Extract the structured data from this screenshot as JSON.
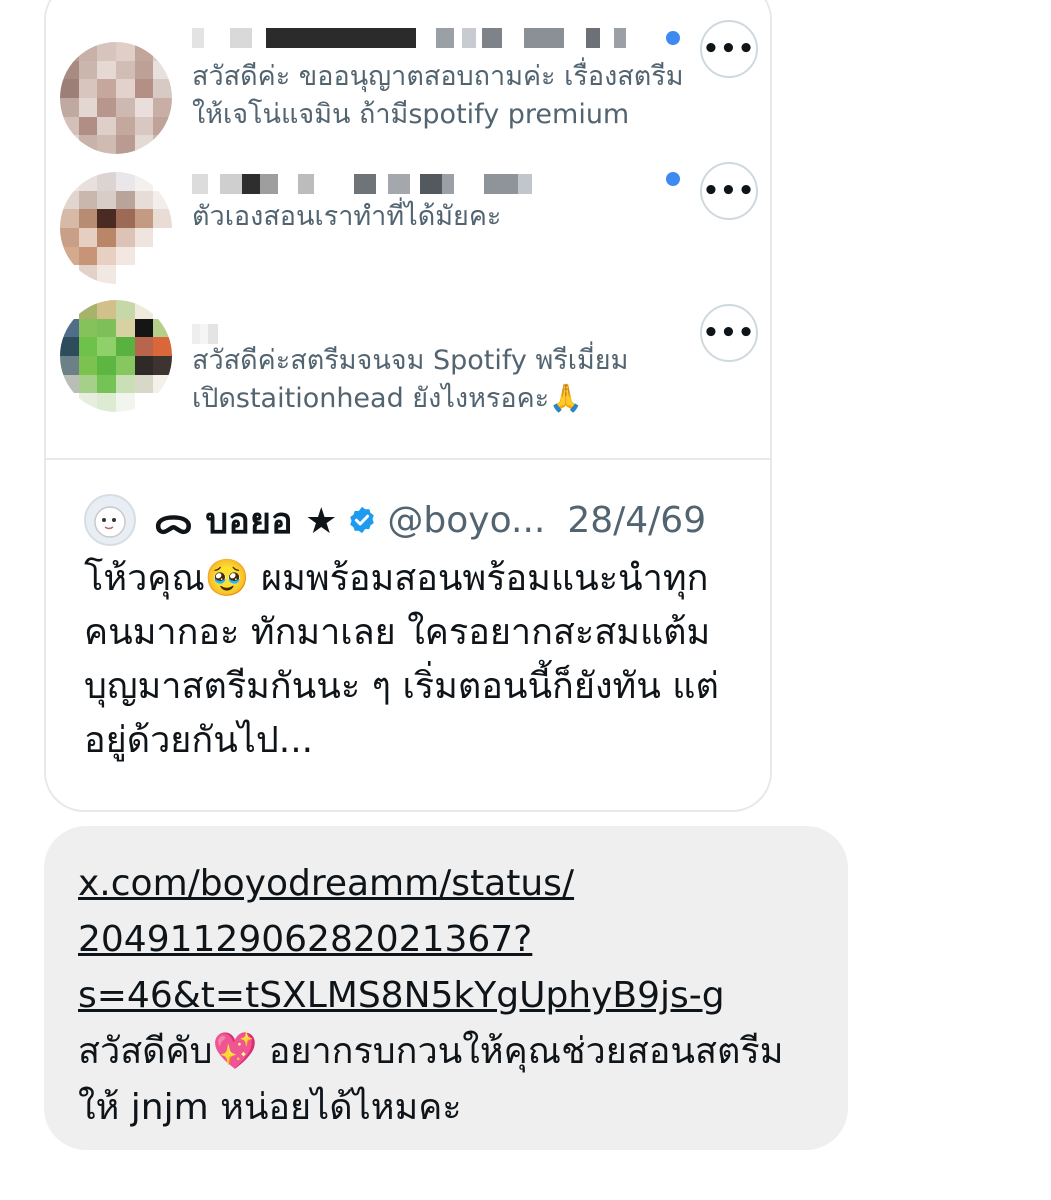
{
  "requests": [
    {
      "preview": "สวัสดีค่ะ ขออนุญาตสอบถามค่ะ เรื่องสตรีมให้เจโน่แจมิน ถ้ามีspotify premium",
      "unread": true
    },
    {
      "preview": "ตัวเองสอนเราทำที่ได้มัยคะ",
      "unread": true
    },
    {
      "preview": "สวัสดีค่ะสตรีมจนจม Spotify พรีเมี่ยมเปิดstaitionhead ยังไงหรอคะ🙏",
      "unread": false
    }
  ],
  "more_glyph": "•••",
  "quoted_tweet": {
    "name": "ฅ^•ﻌ•^ฅ บอยอ ★",
    "name_display": "ᯅ บอยอ ★",
    "handle": "@boyo...",
    "date": "28/4/69",
    "text": "โห้วคุณ🥹 ผมพร้อมสอนพร้อมแนะนำทุกคนมากอะ ทักมาเลย ใครอยากสะสมแต้มบุญมาสตรีมกันนะ ๆ เริ่มตอนนี้ก็ยังทัน แต่อยู่ด้วยกันไป..."
  },
  "message": {
    "link_lines": [
      "x.com/boyodreamm/status/",
      "2049112906282021367?",
      "s=46&t=tSXLMS8N5kYgUphyB9js-g"
    ],
    "text": "สวัสดีคับ💖 อยากรบกวนให้คุณช่วยสอนสตรีมให้ jnjm หน่อยได้ไหมคะ"
  },
  "colors": {
    "unread_dot": "#3d8bf2",
    "verified": "#1d9bf0",
    "bubble": "#efefef",
    "border": "#e6e8eb"
  }
}
